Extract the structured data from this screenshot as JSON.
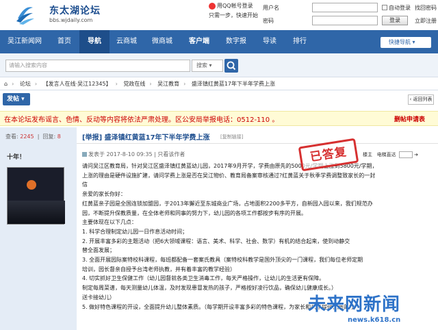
{
  "site": {
    "name": "东太湖论坛",
    "url": "bbs.wjdaily.com"
  },
  "qq_login": {
    "button": "用QQ帐号登录",
    "subtext": "只需一步，快速开始"
  },
  "login": {
    "username_label": "用户名",
    "password_label": "密码",
    "auto_login": "自动登录",
    "find_password": "找回密码",
    "login_button": "登录",
    "register": "立即注册"
  },
  "nav": {
    "items": [
      "吴江新闻网",
      "首页",
      "导航",
      "云商城",
      "微商城",
      "客户端",
      "数字报",
      "导读",
      "排行"
    ],
    "quick_nav": "快捷导航"
  },
  "search": {
    "placeholder": "请输入搜索内容",
    "type": "搜索",
    "icon": "search-icon"
  },
  "breadcrumb": [
    "论坛",
    "【发言人在线·吴江12345】",
    "党政在线",
    "吴江教育",
    "盛泽镇红黄蓝17年下半年学费上涨"
  ],
  "post_button": "发帖",
  "back_button": "返回列表",
  "notice": {
    "text": "在本论坛发布谣言、色情、反动等内容将依法严肃处理。区公安局举报电话：0512-110 。",
    "link": "删帖申请表"
  },
  "author": {
    "views_label": "查看:",
    "views": "2245",
    "replies_label": "回复:",
    "replies": "8",
    "name": "十年！"
  },
  "post": {
    "title": "[举报] 盛泽镇红黄蓝17年下半年学费上涨",
    "title_link": "[复制链接]",
    "meta": "发表于 2017-8-10 09:35 | 只看该作者",
    "stamp": "已答复",
    "tools": [
      "楼主",
      "电梯直达"
    ],
    "paragraphs": [
      "请问吴江区教育局，针对吴江区盛泽镇红黄蓝幼儿园，2017年9月开学，学费由原先的5000元/学期上涨到5800元/学期，",
      "上涨的理由是硬件设施扩建，请问学费上涨是否在吴江物价、教育局备案审核通过?红黄蓝关于秋季学费调整致家长的一封",
      "信",
      "亲爱的家长你好：",
      "红黄蓝亲子园是全国连锁加盟园，于2013年獬近至东城商业广场，占地面积2200多平方，自新园入园以来，我们规范办",
      "园，不断提升保教质量，在全体老师和同事的努力下，幼儿园的各项工作都按步有序的开展。",
      "主要体现在以下几点：",
      "1.      科学合理制定幼儿园一日作息活动时间；",
      "2.      开展丰富多彩的主题活动（把6大领域课程：语言、美术、科学、社会、数学）有机的结合起来，使到动静交",
      "替全面发展；",
      "3.      全面开展园际案特校科课程，每班都配备一套案氏教具（案特校科教学是国外顶尖的一门课程，我们每位老师定期",
      "培训，园长督亲自授予台湾老师执教，并有着丰富的教学经验）",
      "4.      切实抓好卫生保健工作（幼儿园督就各类卫生消毒工作，每天严格操作，让幼儿的生活更有保障。",
      "制定每周菜谱，每天测量幼儿体温，及时发现患冒发热的孩子，严格按好凌行饮品，确保幼儿健康成长。）",
      "送卡接幼儿）",
      "5.      做好特色课程的开设，全面提升幼儿整体素质。（每学期开设丰富多彩的特色课程，为家长和孩子提供优质的教"
    ]
  },
  "watermark": {
    "main": "未来网新闻",
    "url": "news.k618.cn"
  },
  "colors": {
    "nav_blue": "#2f66a8",
    "notice_red": "#cc0000",
    "stamp_red": "#d63030"
  }
}
